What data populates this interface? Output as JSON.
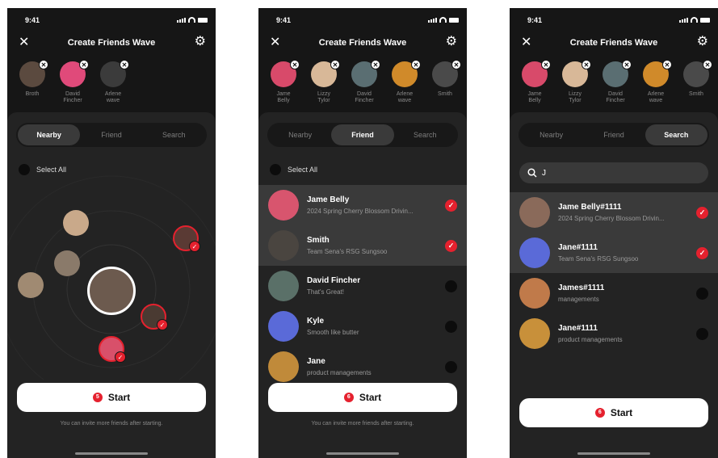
{
  "status": {
    "time": "9:41"
  },
  "header": {
    "title": "Create Friends Wave",
    "close_icon": "close-icon",
    "settings_icon": "gear-icon"
  },
  "tabs": [
    "Nearby",
    "Friend",
    "Search"
  ],
  "select_all": "Select All",
  "start_label": "Start",
  "hint": "You can invite more friends after starting.",
  "colors": {
    "bg": "#161616",
    "panel": "#232323",
    "accent": "#e5212e",
    "highlight": "#3a3a3a"
  },
  "screen1": {
    "active_tab": "Nearby",
    "selected": [
      {
        "name": "Broth",
        "c": "#5b4a3f"
      },
      {
        "name": "David\nFincher",
        "c": "#e04a7a"
      },
      {
        "name": "Arlene\nwave",
        "c": "#3b3b3b"
      }
    ],
    "count": "5"
  },
  "screen2": {
    "active_tab": "Friend",
    "selected": [
      {
        "name": "Jame\nBelly",
        "c": "#d84a6a"
      },
      {
        "name": "Lizzy\nTylor",
        "c": "#d8b898"
      },
      {
        "name": "David\nFincher",
        "c": "#5a6e72"
      },
      {
        "name": "Arlene\nwave",
        "c": "#d08a2a"
      },
      {
        "name": "Smith",
        "c": "#4a4a4a"
      }
    ],
    "friends": [
      {
        "name": "Jame Belly",
        "sub": "2024 Spring Cherry Blossom Drivin...",
        "checked": true,
        "c": "#d8556e"
      },
      {
        "name": "Smith",
        "sub": "Team Sena's RSG Sungsoo",
        "checked": true,
        "c": "#4a4540"
      },
      {
        "name": "David Fincher",
        "sub": "That's Great!",
        "checked": false,
        "c": "#5a7068"
      },
      {
        "name": "Kyle",
        "sub": "Smooth like butter",
        "checked": false,
        "c": "#5a6ad8"
      },
      {
        "name": "Jane",
        "sub": "product managements",
        "checked": false,
        "c": "#c08a3a"
      }
    ],
    "count": "6"
  },
  "screen3": {
    "active_tab": "Search",
    "query": "J",
    "selected": [
      {
        "name": "Jame\nBelly",
        "c": "#d84a6a"
      },
      {
        "name": "Lizzy\nTylor",
        "c": "#d8b898"
      },
      {
        "name": "David\nFincher",
        "c": "#5a6e72"
      },
      {
        "name": "Arlene\nwave",
        "c": "#d08a2a"
      },
      {
        "name": "Smith",
        "c": "#4a4a4a"
      }
    ],
    "results": [
      {
        "name": "Jame Belly#1111",
        "sub": "2024 Spring Cherry Blossom Drivin...",
        "checked": true,
        "c": "#8a6a5a"
      },
      {
        "name": "Jane#1111",
        "sub": "Team Sena's RSG Sungsoo",
        "checked": true,
        "c": "#5a6ad8"
      },
      {
        "name": "James#1111",
        "sub": "managements",
        "checked": false,
        "c": "#c07a4a"
      },
      {
        "name": "Jane#1111",
        "sub": "product managements",
        "checked": false,
        "c": "#c8903a"
      }
    ],
    "count": "6"
  }
}
